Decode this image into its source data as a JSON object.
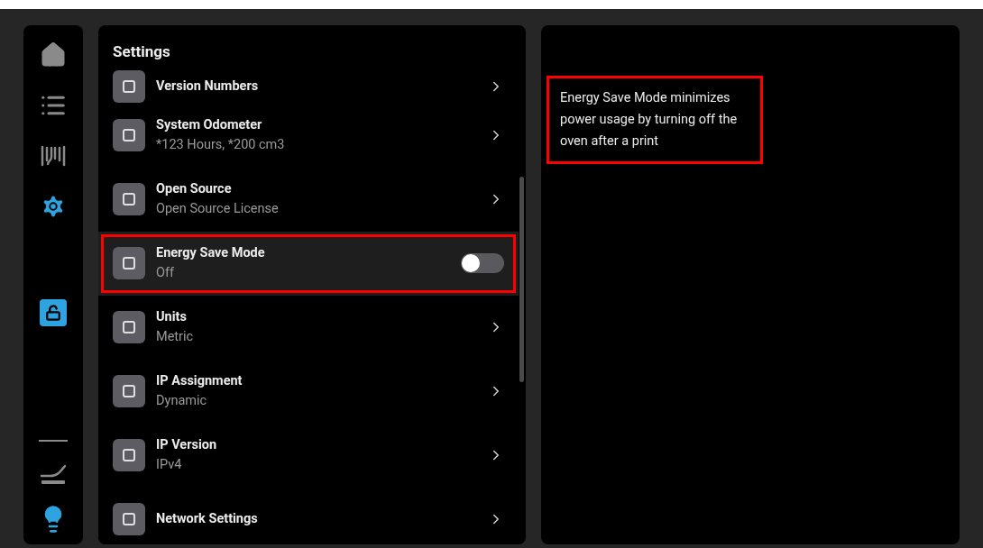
{
  "sidebar": {
    "nav": [
      {
        "kind": "home",
        "selected": false
      },
      {
        "kind": "list",
        "selected": false
      },
      {
        "kind": "spool",
        "selected": false
      },
      {
        "kind": "settings",
        "selected": true
      }
    ],
    "lock": {
      "locked": false
    },
    "light": {
      "on": true
    }
  },
  "settings": {
    "title": "Settings",
    "rows": [
      {
        "kind": "link",
        "title": "Version Numbers",
        "selected": false
      },
      {
        "kind": "link",
        "title": "System Odometer",
        "subtitle": "*123 Hours, *200 cm3",
        "selected": false
      },
      {
        "kind": "link",
        "title": "Open Source",
        "subtitle": "Open Source License",
        "selected": false
      },
      {
        "kind": "toggle",
        "title": "Energy Save Mode",
        "subtitle": "Off",
        "on": false,
        "selected": true,
        "highlighted": true
      },
      {
        "kind": "link",
        "title": "Units",
        "subtitle": "Metric",
        "selected": false
      },
      {
        "kind": "link",
        "title": "IP Assignment",
        "subtitle": "Dynamic",
        "selected": false
      },
      {
        "kind": "link",
        "title": "IP Version",
        "subtitle": "IPv4",
        "selected": false
      },
      {
        "kind": "link",
        "title": "Network Settings",
        "selected": false
      }
    ]
  },
  "detail": {
    "text": "Energy Save Mode minimizes power usage by turning off the oven after a print",
    "highlighted": true
  }
}
